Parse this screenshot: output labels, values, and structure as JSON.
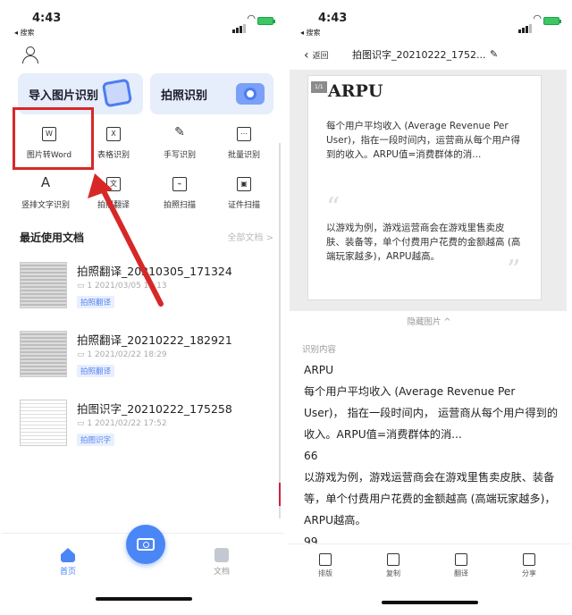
{
  "status": {
    "time": "4:43",
    "back_app": "◂ 搜索"
  },
  "left": {
    "cards": [
      {
        "label": "导入图片识别"
      },
      {
        "label": "拍照识别"
      }
    ],
    "tools": [
      {
        "label": "图片转Word",
        "icon": "word-doc-icon",
        "glyph": "W"
      },
      {
        "label": "表格识别",
        "icon": "excel-doc-icon",
        "glyph": "X"
      },
      {
        "label": "手写识别",
        "icon": "feather-icon",
        "glyph": "✎"
      },
      {
        "label": "批量识别",
        "icon": "batch-doc-icon",
        "glyph": "⋯"
      },
      {
        "label": "竖排文字识别",
        "icon": "vertical-text-icon",
        "glyph": "A"
      },
      {
        "label": "拍照翻译",
        "icon": "translate-icon",
        "glyph": "文"
      },
      {
        "label": "拍照扫描",
        "icon": "scan-icon",
        "glyph": "⌁"
      },
      {
        "label": "证件扫描",
        "icon": "id-card-icon",
        "glyph": "▣"
      }
    ],
    "recent_title": "最近使用文档",
    "all_docs": "全部文档 >",
    "docs": [
      {
        "name": "拍照翻译_20210305_171324",
        "meta": "▭ 1   2021/03/05 17:13",
        "tag": "拍照翻译"
      },
      {
        "name": "拍照翻译_20210222_182921",
        "meta": "▭ 1   2021/02/22 18:29",
        "tag": "拍照翻译"
      },
      {
        "name": "拍图识字_20210222_175258",
        "meta": "▭ 1   2021/02/22 17:52",
        "tag": "拍图识字"
      }
    ],
    "tabbar": {
      "home": "首页",
      "docs": "文档"
    }
  },
  "right": {
    "back": "返回",
    "title": "拍图识字_20210222_1752...",
    "page_badge": "1/1",
    "image_heading": "ARPU",
    "image_para1": "每个用户平均收入 (Average Revenue Per User)，指在一段时间内，运营商从每个用户得到的收入。ARPU值=消费群体的消...",
    "image_para2": "以游戏为例，游戏运营商会在游戏里售卖皮肤、装备等，单个付费用户花费的金额越高 (高端玩家越多)，ARPU越高。",
    "hide_image": "隐藏图片 ^",
    "recognized_label": "识别内容",
    "recognized_lines": [
      "ARPU",
      "每个用户平均收入 (Average Revenue Per User)， 指在一段时间内， 运营商从每个用户得到的收入。ARPU值=消费群体的消...",
      "66",
      "以游戏为例，游戏运营商会在游戏里售卖皮肤、装备等，单个付费用户花费的金额越高 (高端玩家越多)，ARPU越高。",
      "99"
    ],
    "bottombar": [
      {
        "label": "排版",
        "icon": "layout-icon"
      },
      {
        "label": "复制",
        "icon": "copy-icon"
      },
      {
        "label": "翻译",
        "icon": "translate-icon"
      },
      {
        "label": "分享",
        "icon": "share-icon"
      }
    ]
  },
  "colors": {
    "accent": "#4b86f6",
    "highlight": "#d72828",
    "card_bg": "#e6edfb"
  }
}
